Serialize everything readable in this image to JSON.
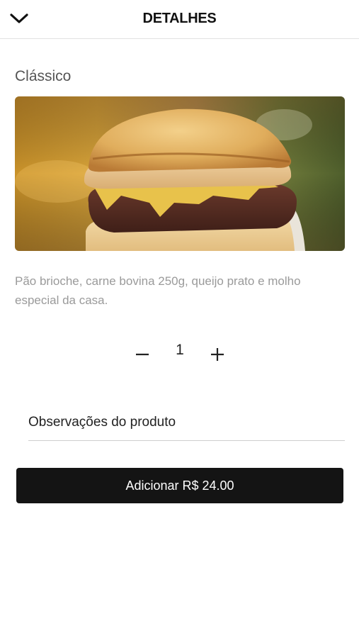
{
  "header": {
    "title": "DETALHES",
    "back_icon": "chevron-down-icon"
  },
  "product": {
    "name": "Clássico",
    "image_alt": "burger-photo",
    "description": "Pão brioche, carne bovina 250g, queijo prato e molho especial da casa."
  },
  "quantity": {
    "minus_label": "−",
    "value": "1",
    "plus_label": "+"
  },
  "notes": {
    "placeholder": "Observações do produto",
    "value": ""
  },
  "add_button": {
    "label": "Adicionar R$ 24.00"
  },
  "colors": {
    "button_bg": "#141414",
    "button_text": "#ffffff",
    "description_text": "#9a9a9a"
  }
}
